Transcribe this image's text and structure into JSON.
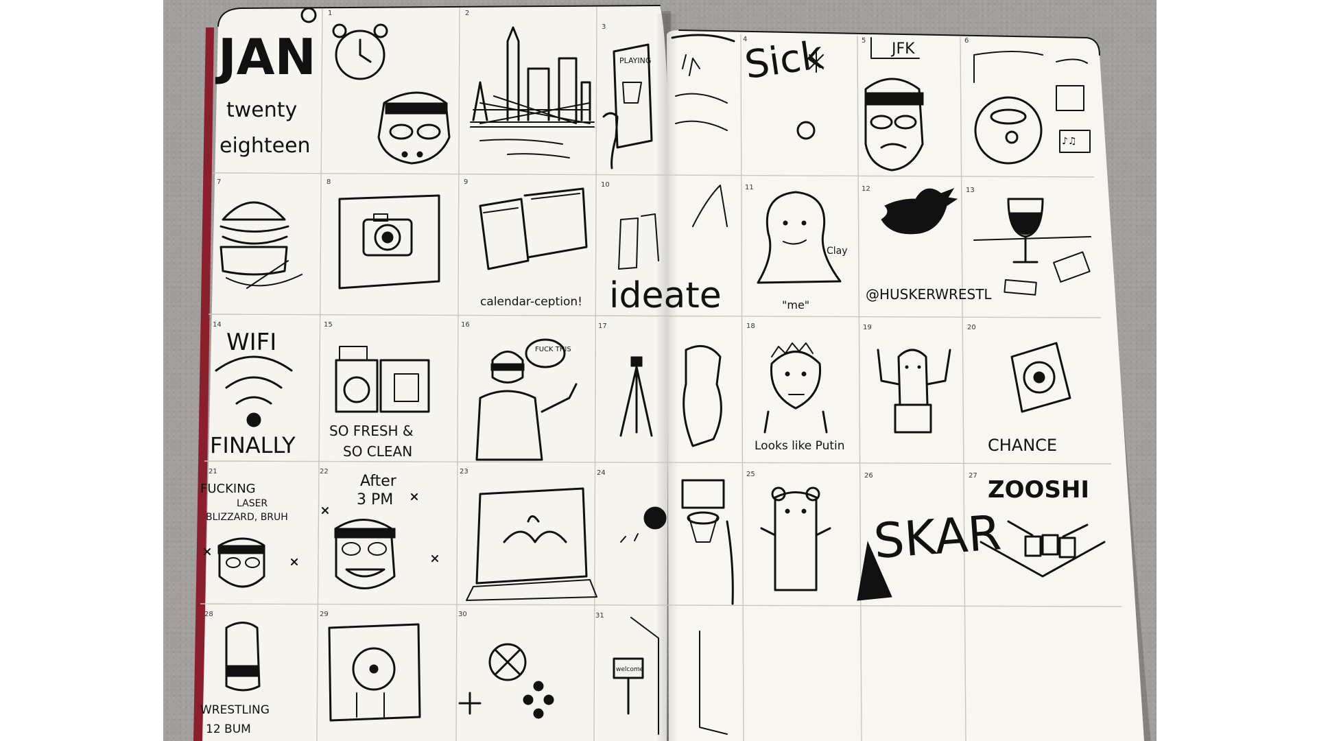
{
  "header": {
    "month": "JAN",
    "year_line1": "twenty",
    "year_line2": "eighteen"
  },
  "days": [
    {
      "day": "1",
      "caption": ""
    },
    {
      "day": "2",
      "caption": ""
    },
    {
      "day": "3",
      "caption": "PLAYING"
    },
    {
      "day": "4",
      "caption": "Sick"
    },
    {
      "day": "5",
      "caption": "JFK"
    },
    {
      "day": "6",
      "caption": ""
    },
    {
      "day": "7",
      "caption": ""
    },
    {
      "day": "8",
      "caption": ""
    },
    {
      "day": "9",
      "caption": "calendar-ception!"
    },
    {
      "day": "10",
      "caption": "ideate"
    },
    {
      "day": "11",
      "caption": "\"me\""
    },
    {
      "day": "12",
      "caption": "@HUSKERWRESTL"
    },
    {
      "day": "13",
      "caption": ""
    },
    {
      "day": "14",
      "caption": "WIFI FINALLY"
    },
    {
      "day": "15",
      "caption": "SO FRESH & SO CLEAN"
    },
    {
      "day": "16",
      "caption": "FUCK THIS"
    },
    {
      "day": "17",
      "caption": ""
    },
    {
      "day": "18",
      "caption": "Looks like Putin"
    },
    {
      "day": "19",
      "caption": ""
    },
    {
      "day": "20",
      "caption": "CHANCE"
    },
    {
      "day": "21",
      "caption": "FUCKING LASER BLIZZARD, BRUH"
    },
    {
      "day": "22",
      "caption": "After 3 PM"
    },
    {
      "day": "23",
      "caption": ""
    },
    {
      "day": "24",
      "caption": ""
    },
    {
      "day": "25",
      "caption": ""
    },
    {
      "day": "26",
      "caption": "SKAR"
    },
    {
      "day": "27",
      "caption": "ZOOSHI"
    },
    {
      "day": "28",
      "caption": "WRESTLING 12 BUM"
    },
    {
      "day": "29",
      "caption": ""
    },
    {
      "day": "30",
      "caption": ""
    },
    {
      "day": "31",
      "caption": ""
    }
  ],
  "extra_labels": {
    "clay": "Clay",
    "welcome": "welcome"
  },
  "colors": {
    "background": "#ffffff",
    "table": "#a19f9c",
    "paper": "#f6f4ee",
    "ink": "#111111",
    "notebook_edge": "#8b1f2b"
  }
}
